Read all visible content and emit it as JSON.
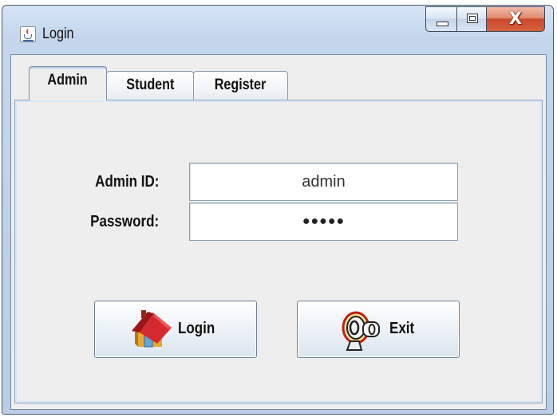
{
  "window": {
    "title": "Login",
    "close_glyph": "X"
  },
  "tabs": [
    {
      "label": "Admin",
      "active": true
    },
    {
      "label": "Student",
      "active": false
    },
    {
      "label": "Register",
      "active": false
    }
  ],
  "form": {
    "admin_id_label": "Admin ID:",
    "admin_id_value": "admin",
    "password_label": "Password:",
    "password_value": "●●●●●"
  },
  "buttons": {
    "login_label": "Login",
    "exit_label": "Exit"
  },
  "icons": {
    "app": "java-cup-icon",
    "login": "home-icon",
    "exit": "key-icon"
  },
  "colors": {
    "title_gradient_top": "#d6e5f5",
    "close_button": "#cc4a2c",
    "panel": "#eeeeee",
    "login_roof": "#c8262b",
    "login_wall": "#e6a62b"
  }
}
